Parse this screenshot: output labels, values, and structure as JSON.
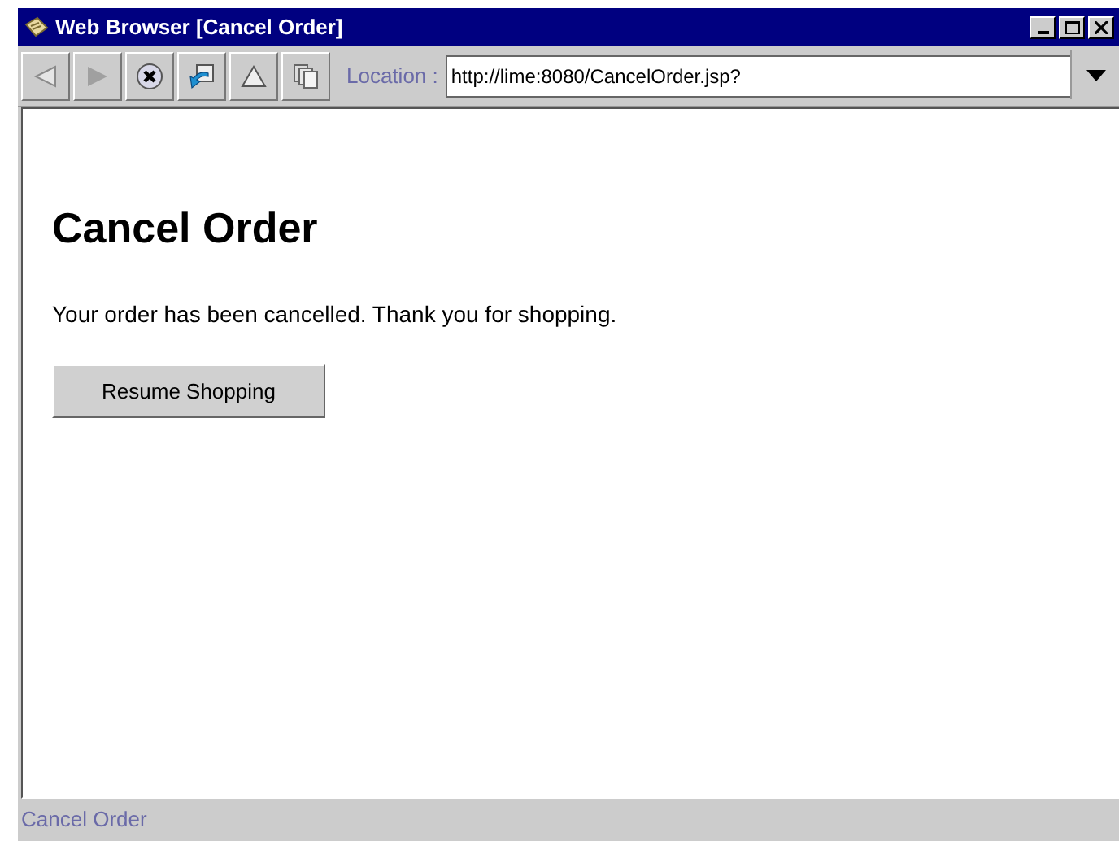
{
  "window": {
    "title": "Web Browser [Cancel Order]"
  },
  "toolbar": {
    "buttons": [
      {
        "kind": "back"
      },
      {
        "kind": "forward"
      },
      {
        "kind": "stop"
      },
      {
        "kind": "reload"
      },
      {
        "kind": "home"
      },
      {
        "kind": "copy"
      }
    ],
    "location_label": "Location :",
    "location_value": "http://lime:8080/CancelOrder.jsp?"
  },
  "page": {
    "heading": "Cancel Order",
    "message": "Your order has been cancelled. Thank you for shopping.",
    "button": "Resume Shopping"
  },
  "status_bar": "Cancel Order"
}
